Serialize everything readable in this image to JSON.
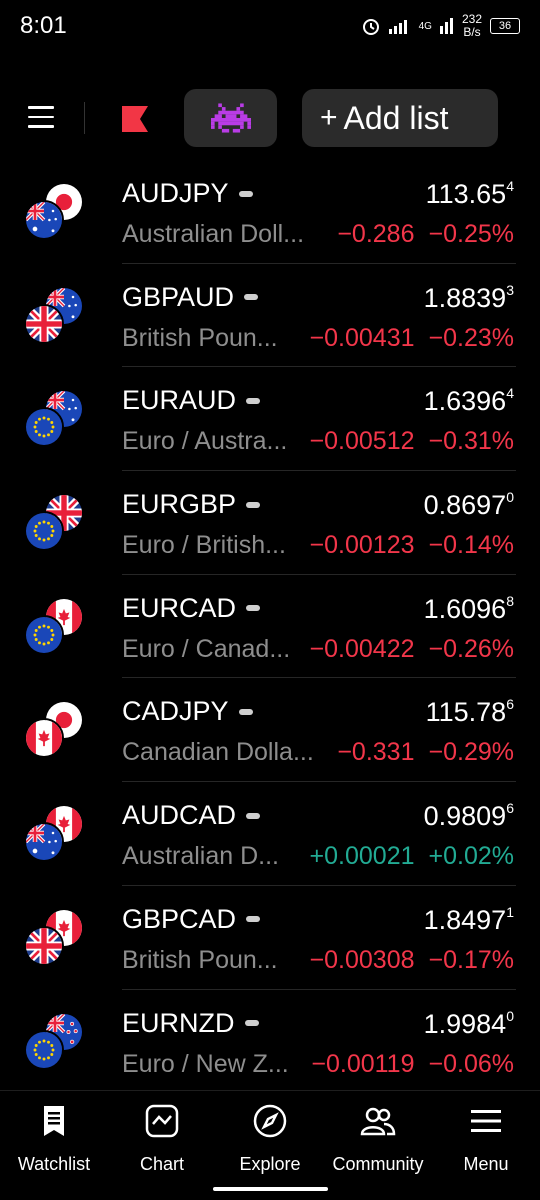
{
  "status": {
    "time": "8:01",
    "network": "4G",
    "speed_value": "232",
    "speed_unit": "B/s",
    "battery": "36"
  },
  "toolbar": {
    "add_list_label": "Add list"
  },
  "colors": {
    "accent": "#f23645",
    "negative": "#f2364a",
    "positive": "#22ab94",
    "pill": "#2b2b2b"
  },
  "watchlist": [
    {
      "symbol": "AUDJPY",
      "desc": "Australian Doll...",
      "price": "113.65",
      "price_sup": "4",
      "change_abs": "−0.286",
      "change_pct": "−0.25%",
      "direction": "neg",
      "flag_back": "jp",
      "flag_front": "au"
    },
    {
      "symbol": "GBPAUD",
      "desc": "British Poun...",
      "price": "1.8839",
      "price_sup": "3",
      "change_abs": "−0.00431",
      "change_pct": "−0.23%",
      "direction": "neg",
      "flag_back": "au",
      "flag_front": "gb"
    },
    {
      "symbol": "EURAUD",
      "desc": "Euro / Austra...",
      "price": "1.6396",
      "price_sup": "4",
      "change_abs": "−0.00512",
      "change_pct": "−0.31%",
      "direction": "neg",
      "flag_back": "au",
      "flag_front": "eu"
    },
    {
      "symbol": "EURGBP",
      "desc": "Euro / British...",
      "price": "0.8697",
      "price_sup": "0",
      "change_abs": "−0.00123",
      "change_pct": "−0.14%",
      "direction": "neg",
      "flag_back": "gb",
      "flag_front": "eu"
    },
    {
      "symbol": "EURCAD",
      "desc": "Euro / Canad...",
      "price": "1.6096",
      "price_sup": "8",
      "change_abs": "−0.00422",
      "change_pct": "−0.26%",
      "direction": "neg",
      "flag_back": "ca",
      "flag_front": "eu"
    },
    {
      "symbol": "CADJPY",
      "desc": "Canadian Dolla...",
      "price": "115.78",
      "price_sup": "6",
      "change_abs": "−0.331",
      "change_pct": "−0.29%",
      "direction": "neg",
      "flag_back": "jp",
      "flag_front": "ca"
    },
    {
      "symbol": "AUDCAD",
      "desc": "Australian D...",
      "price": "0.9809",
      "price_sup": "6",
      "change_abs": "+0.00021",
      "change_pct": "+0.02%",
      "direction": "pos",
      "flag_back": "ca",
      "flag_front": "au"
    },
    {
      "symbol": "GBPCAD",
      "desc": "British Poun...",
      "price": "1.8497",
      "price_sup": "1",
      "change_abs": "−0.00308",
      "change_pct": "−0.17%",
      "direction": "neg",
      "flag_back": "ca",
      "flag_front": "gb"
    },
    {
      "symbol": "EURNZD",
      "desc": "Euro / New Z...",
      "price": "1.9984",
      "price_sup": "0",
      "change_abs": "−0.00119",
      "change_pct": "−0.06%",
      "direction": "neg",
      "flag_back": "nz",
      "flag_front": "eu"
    }
  ],
  "nav": {
    "watchlist": "Watchlist",
    "chart": "Chart",
    "explore": "Explore",
    "community": "Community",
    "menu": "Menu"
  }
}
